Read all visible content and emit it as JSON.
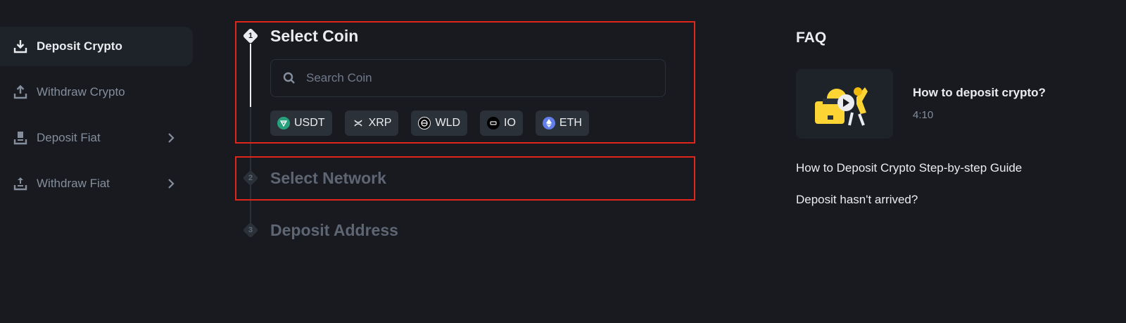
{
  "sidebar": {
    "items": [
      {
        "label": "Deposit Crypto",
        "icon": "download-icon",
        "active": true
      },
      {
        "label": "Withdraw Crypto",
        "icon": "upload-icon",
        "active": false
      },
      {
        "label": "Deposit Fiat",
        "icon": "deposit-fiat-icon",
        "active": false,
        "has_submenu": true
      },
      {
        "label": "Withdraw Fiat",
        "icon": "withdraw-fiat-icon",
        "active": false,
        "has_submenu": true
      }
    ]
  },
  "steps": [
    {
      "number": "1",
      "title": "Select Coin",
      "state": "active"
    },
    {
      "number": "2",
      "title": "Select Network",
      "state": "inactive"
    },
    {
      "number": "3",
      "title": "Deposit Address",
      "state": "inactive"
    }
  ],
  "search": {
    "placeholder": "Search Coin",
    "value": ""
  },
  "coins": [
    {
      "label": "USDT",
      "icon": "usdt-icon",
      "color": "#26a17b"
    },
    {
      "label": "XRP",
      "icon": "xrp-icon",
      "color": "#2b3139"
    },
    {
      "label": "WLD",
      "icon": "wld-icon",
      "color": "#000000"
    },
    {
      "label": "IO",
      "icon": "io-icon",
      "color": "#000000"
    },
    {
      "label": "ETH",
      "icon": "eth-icon",
      "color": "#627eea"
    }
  ],
  "faq": {
    "title": "FAQ",
    "video": {
      "title": "How to deposit crypto?",
      "duration": "4:10"
    },
    "links": [
      "How to Deposit Crypto Step-by-step Guide",
      "Deposit hasn't arrived?"
    ]
  },
  "colors": {
    "background": "#181a20",
    "panel": "#1e2329",
    "chip": "#2b3139",
    "text_primary": "#eaecef",
    "text_muted": "#848e9c",
    "text_disabled": "#5e6673",
    "highlight_box": "#e0261b",
    "accent_yellow": "#fcd535"
  }
}
